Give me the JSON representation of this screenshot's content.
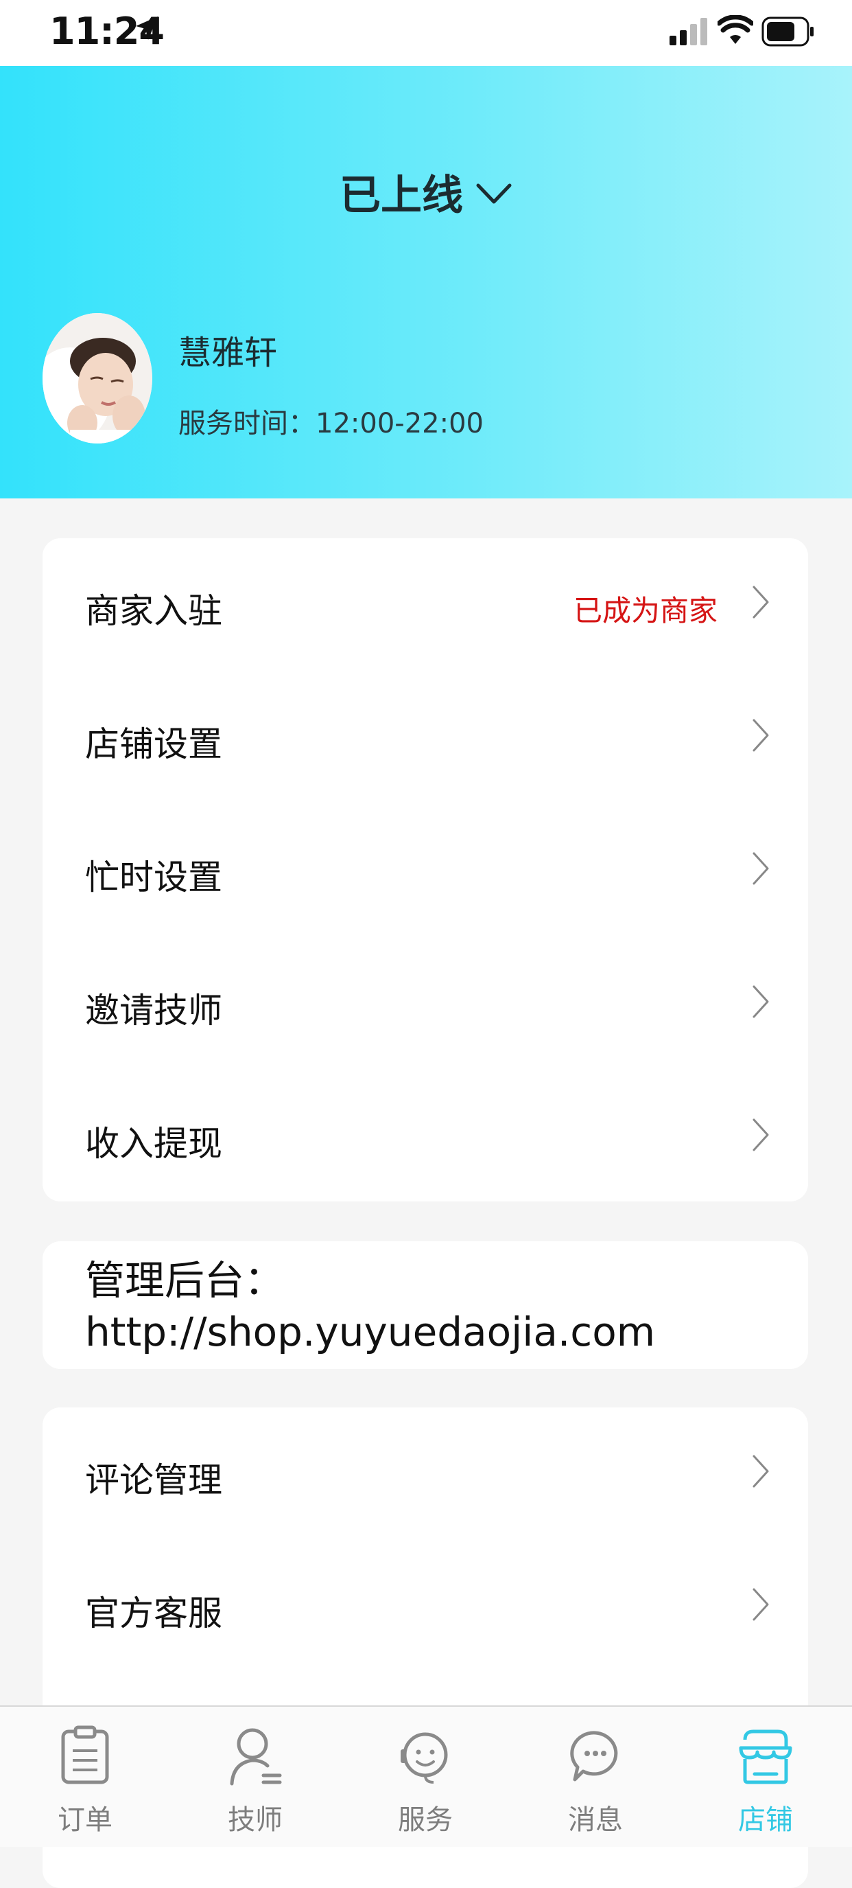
{
  "status_bar": {
    "time": "11:24"
  },
  "header": {
    "status_label": "已上线",
    "shop_name": "慧雅轩",
    "service_time": "服务时间：12:00-22:00"
  },
  "menu_group_1": [
    {
      "label": "商家入驻",
      "tag": "已成为商家"
    },
    {
      "label": "店铺设置",
      "tag": ""
    },
    {
      "label": "忙时设置",
      "tag": ""
    },
    {
      "label": "邀请技师",
      "tag": ""
    },
    {
      "label": "收入提现",
      "tag": ""
    }
  ],
  "admin": {
    "label": "管理后台：",
    "url": "http://shop.yuyuedaojia.com"
  },
  "menu_group_2": [
    {
      "label": "评论管理"
    },
    {
      "label": "官方客服"
    }
  ],
  "tabs": [
    {
      "label": "订单",
      "icon": "clipboard-icon",
      "active": false
    },
    {
      "label": "技师",
      "icon": "person-icon",
      "active": false
    },
    {
      "label": "服务",
      "icon": "headset-face-icon",
      "active": false
    },
    {
      "label": "消息",
      "icon": "chat-bubble-icon",
      "active": false
    },
    {
      "label": "店铺",
      "icon": "store-icon",
      "active": true
    }
  ],
  "colors": {
    "accent": "#32c8e4",
    "header_gradient_start": "#33e2fb",
    "header_gradient_end": "#a8f3fb",
    "tag_red": "#d51414"
  }
}
